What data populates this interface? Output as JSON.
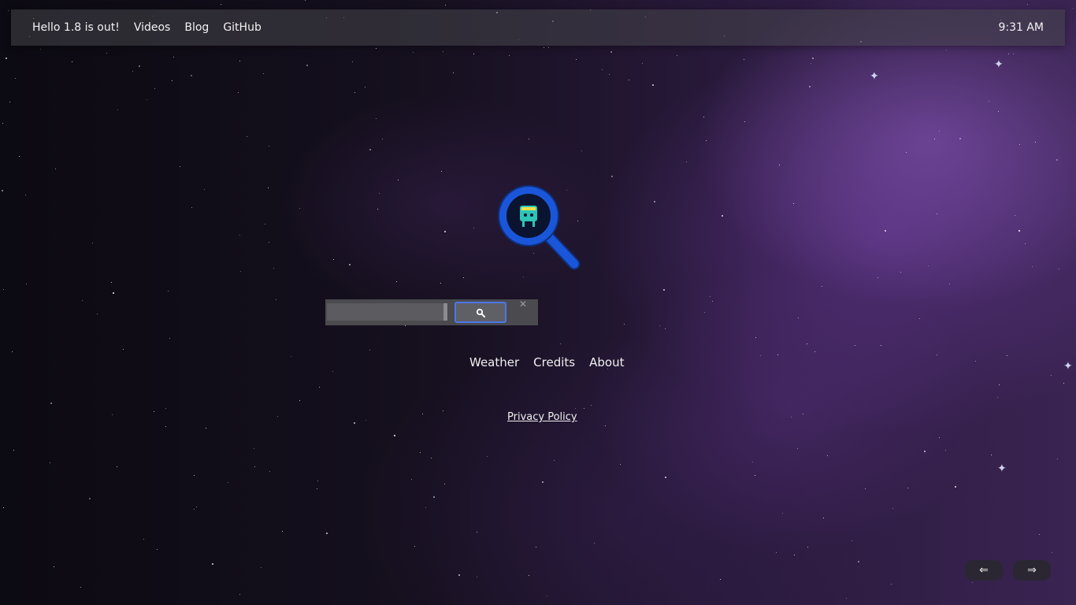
{
  "header": {
    "announcement": "Hello 1.8 is out!",
    "nav": [
      "Videos",
      "Blog",
      "GitHub"
    ],
    "time": "9:31 AM"
  },
  "logo": {
    "name": "magnifier-logo",
    "colors": {
      "ring": "#1a56d9",
      "inner": "#0a1a3a",
      "mascot": "#2ec4b6"
    }
  },
  "search": {
    "placeholder": "",
    "value": "",
    "button_icon": "search-icon",
    "clear_icon": "close-icon"
  },
  "links": [
    "Weather",
    "Credits",
    "About"
  ],
  "privacy_policy": "Privacy Policy",
  "pager": {
    "prev": "⇐",
    "next": "⇒"
  },
  "colors": {
    "accent": "#4d78e8",
    "topbar": "#46464b"
  }
}
